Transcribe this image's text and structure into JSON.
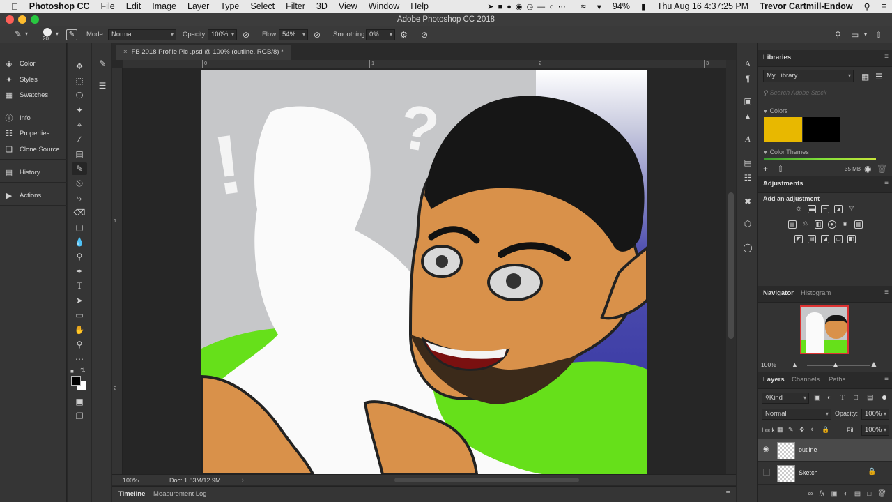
{
  "menubar": {
    "apple_icon": "apple-logo",
    "app_name": "Photoshop CC",
    "items": [
      "File",
      "Edit",
      "Image",
      "Layer",
      "Type",
      "Select",
      "Filter",
      "3D",
      "View",
      "Window",
      "Help"
    ],
    "battery": "94%",
    "clock": "Thu Aug 16  4:37:25 PM",
    "user": "Trevor Cartmill-Endow"
  },
  "window": {
    "title": "Adobe Photoshop CC 2018"
  },
  "options_bar": {
    "brush_size": "20",
    "mode_label": "Mode:",
    "mode_value": "Normal",
    "opacity_label": "Opacity:",
    "opacity_value": "100%",
    "flow_label": "Flow:",
    "flow_value": "54%",
    "smoothing_label": "Smoothing:",
    "smoothing_value": "0%"
  },
  "left_dock": {
    "groups": [
      [
        {
          "label": "Color",
          "icon": "color-palette-icon"
        },
        {
          "label": "Styles",
          "icon": "styles-icon"
        },
        {
          "label": "Swatches",
          "icon": "swatches-grid-icon"
        }
      ],
      [
        {
          "label": "Info",
          "icon": "info-icon"
        },
        {
          "label": "Properties",
          "icon": "properties-icon"
        },
        {
          "label": "Clone Source",
          "icon": "clone-source-icon"
        }
      ],
      [
        {
          "label": "History",
          "icon": "history-icon"
        }
      ],
      [
        {
          "label": "Actions",
          "icon": "play-icon"
        }
      ]
    ]
  },
  "document": {
    "tab_title": "FB 2018 Profile Pic .psd @ 100% (outline, RGB/8) *",
    "ruler_h_ticks": [
      "0",
      "1",
      "2",
      "3"
    ],
    "ruler_v_ticks": [
      "1",
      "2"
    ],
    "doodle_marks": [
      "!",
      "?"
    ],
    "zoom": "100%",
    "doc_info": "Doc: 1.83M/12.9M"
  },
  "bottom_tabs": [
    "Timeline",
    "Measurement Log"
  ],
  "libraries": {
    "title": "Libraries",
    "library_name": "My Library",
    "search_placeholder": "Search Adobe Stock",
    "colors_label": "Colors",
    "swatches": [
      "#e8b800",
      "#000000"
    ],
    "themes_label": "Color Themes",
    "storage": "35 MB"
  },
  "adjustments": {
    "title": "Adjustments",
    "subtitle": "Add an adjustment"
  },
  "navigator": {
    "tabs": [
      "Navigator",
      "Histogram"
    ],
    "zoom": "100%"
  },
  "layers_panel": {
    "tabs": [
      "Layers",
      "Channels",
      "Paths"
    ],
    "filter_label": "Kind",
    "blend_mode": "Normal",
    "opacity_label": "Opacity:",
    "opacity_value": "100%",
    "lock_label": "Lock:",
    "fill_label": "Fill:",
    "fill_value": "100%",
    "layers": [
      {
        "name": "outline",
        "visible": true,
        "selected": true,
        "locked": false
      },
      {
        "name": "Sketch",
        "visible": false,
        "selected": false,
        "locked": true
      }
    ]
  },
  "colors": {
    "accent_green": "#66e01a",
    "skin": "#d9914a",
    "foreground": "#000000",
    "background": "#ffffff"
  }
}
